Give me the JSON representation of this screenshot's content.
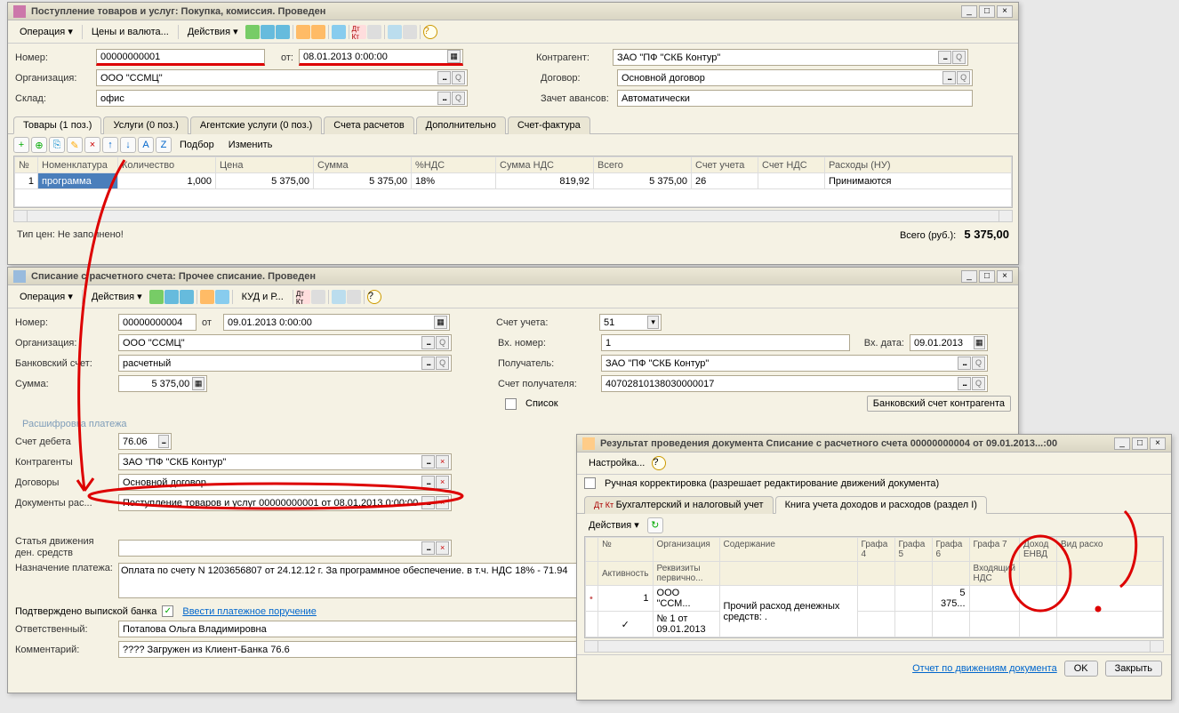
{
  "win1": {
    "title": "Поступление товаров и услуг: Покупка, комиссия. Проведен",
    "toolbar": {
      "operation": "Операция ▾",
      "prices": "Цены и валюта...",
      "actions": "Действия ▾"
    },
    "fields": {
      "number_label": "Номер:",
      "number": "00000000001",
      "from_label": "от:",
      "date": "08.01.2013 0:00:00",
      "org_label": "Организация:",
      "org": "ООО \"ССМЦ\"",
      "warehouse_label": "Склад:",
      "warehouse": "офис",
      "contragent_label": "Контрагент:",
      "contragent": "ЗАО \"ПФ \"СКБ Контур\"",
      "contract_label": "Договор:",
      "contract": "Основной договор",
      "advance_label": "Зачет авансов:",
      "advance": "Автоматически"
    },
    "tabs": [
      "Товары (1 поз.)",
      "Услуги (0 поз.)",
      "Агентские услуги (0 поз.)",
      "Счета расчетов",
      "Дополнительно",
      "Счет-фактура"
    ],
    "sub_toolbar": {
      "select": "Подбор",
      "edit": "Изменить"
    },
    "grid": {
      "cols": [
        "№",
        "Номенклатура",
        "Количество",
        "Цена",
        "Сумма",
        "%НДС",
        "Сумма НДС",
        "Всего",
        "Счет учета",
        "Счет НДС",
        "Расходы (НУ)"
      ],
      "row": {
        "n": "1",
        "nom": "программа",
        "qty": "1,000",
        "price": "5 375,00",
        "sum": "5 375,00",
        "vat": "18%",
        "vat_sum": "819,92",
        "total": "5 375,00",
        "acct": "26",
        "vat_acct": "",
        "exp": "Принимаются"
      }
    },
    "price_type": "Тип цен: Не заполнено!",
    "total_label": "Всего (руб.):",
    "total": "5 375,00"
  },
  "win2": {
    "title": "Списание с расчетного счета: Прочее списание. Проведен",
    "toolbar": {
      "operation": "Операция ▾",
      "actions": "Действия ▾",
      "kudir": "КУД и Р..."
    },
    "fields": {
      "number_label": "Номер:",
      "number": "00000000004",
      "from_label": "от",
      "date": "09.01.2013 0:00:00",
      "org_label": "Организация:",
      "org": "ООО \"ССМЦ\"",
      "bank_label": "Банковский счет:",
      "bank": "расчетный",
      "sum_label": "Сумма:",
      "sum": "5 375,00",
      "acct_label": "Счет учета:",
      "acct": "51",
      "inno_label": "Вх. номер:",
      "inno": "1",
      "indate_label": "Вх. дата:",
      "indate": "09.01.2013",
      "recv_label": "Получатель:",
      "recv": "ЗАО \"ПФ \"СКБ Контур\"",
      "recv_acct_label": "Счет получателя:",
      "recv_acct": "40702810138030000017",
      "list": "Список",
      "bank_btn": "Банковский счет контрагента",
      "section": "Расшифровка платежа",
      "deb_label": "Счет дебета",
      "deb": "76.06",
      "contr_label": "Контрагенты",
      "contr": "ЗАО \"ПФ \"СКБ Контур\"",
      "dog_label": "Договоры",
      "dog": "Основной договор",
      "docs_label": "Документы рас...",
      "docs": "Поступление товаров и услуг 00000000001 от 08.01.2013 0:00:00",
      "move_label": "Статья движения ден. средств",
      "purpose_label": "Назначение платежа:",
      "purpose": "Оплата по счету N 1203656807 от 24.12.12 г. За программное обеспечение. в т.ч. НДС 18% - 71.94",
      "confirm_label": "Подтверждено выпиской банка",
      "pp_link": "Ввести платежное поручение",
      "resp_label": "Ответственный:",
      "resp": "Потапова Ольга Владимировна",
      "comment_label": "Комментарий:",
      "comment": "???? Загружен из Клиент-Банка 76.6"
    }
  },
  "win3": {
    "title": "Результат проведения документа Списание с расчетного счета 00000000004 от 09.01.2013...:00",
    "settings": "Настройка...",
    "manual": "Ручная корректировка (разрешает редактирование движений документа)",
    "tabs": [
      "Бухгалтерский и налоговый учет",
      "Книга учета доходов и расходов (раздел I)"
    ],
    "actions": "Действия ▾",
    "grid": {
      "cols_r1": [
        "№",
        "Организация",
        "Содержание",
        "Графа 4",
        "Графа 5",
        "Графа 6",
        "Графа 7",
        "Доход ЕНВД",
        "Вид расхо"
      ],
      "cols_r2": [
        "Активность",
        "Реквизиты первично...",
        "",
        "",
        "",
        "",
        "Входящий НДС",
        "",
        ""
      ],
      "row": {
        "n": "1",
        "org": "ООО \"ССМ...",
        "content": "Прочий расход денежных средств: .",
        "g6": "5 375...",
        "rec": "№ 1 от 09.01.2013",
        "act": "✓"
      }
    },
    "footer_link": "Отчет по движениям документа",
    "ok": "OK",
    "close": "Закрыть"
  }
}
